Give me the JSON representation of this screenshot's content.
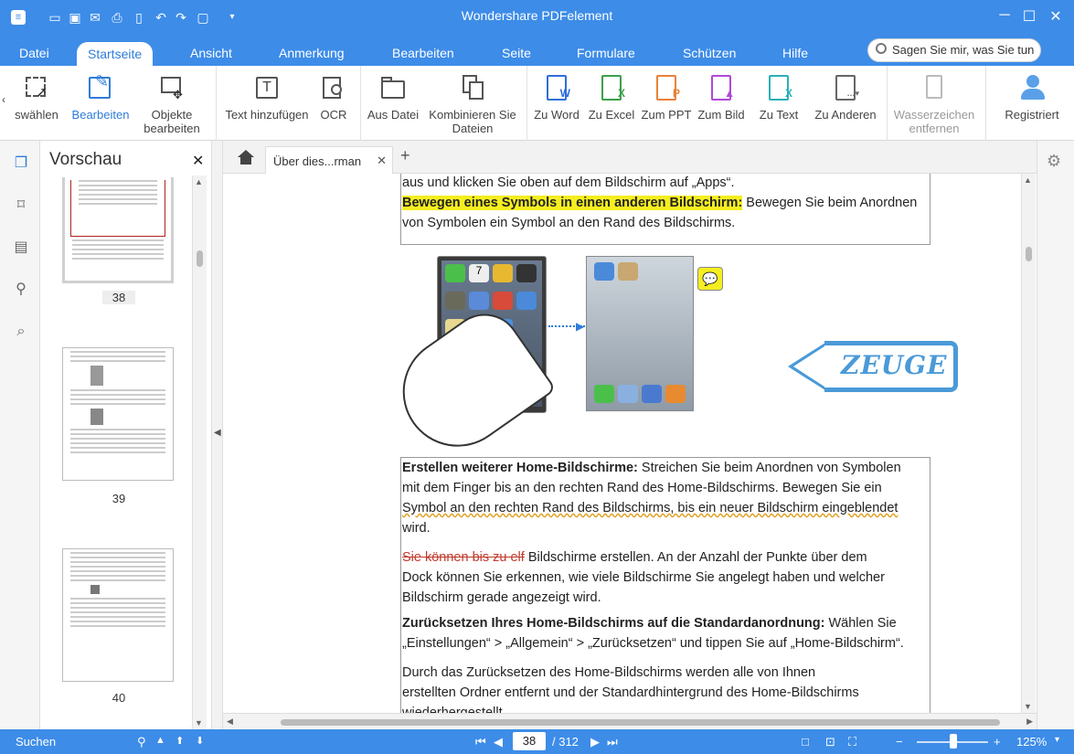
{
  "app": {
    "title": "Wondershare PDFelement"
  },
  "menu": {
    "tabs": [
      "Datei",
      "Startseite",
      "Ansicht",
      "Anmerkung",
      "Bearbeiten",
      "Seite",
      "Formulare",
      "Schützen",
      "Hilfe"
    ],
    "active": "Startseite",
    "search_placeholder": "Sagen Sie mir, was Sie tun"
  },
  "ribbon": {
    "select": "swählen",
    "edit": "Bearbeiten",
    "objects_1": "Objekte",
    "objects_2": "bearbeiten",
    "add_text": "Text hinzufügen",
    "ocr": "OCR",
    "from_file": "Aus Datei",
    "combine_1": "Kombinieren Sie",
    "combine_2": "Dateien",
    "to_word": "Zu Word",
    "to_excel": "Zu Excel",
    "to_ppt": "Zum PPT",
    "to_image": "Zum Bild",
    "to_text": "Zu Text",
    "to_other": "Zu Anderen",
    "remove_wm_1": "Wasserzeichen",
    "remove_wm_2": "entfernen",
    "registered": "Registriert"
  },
  "preview": {
    "title": "Vorschau",
    "pages": [
      "38",
      "39",
      "40"
    ]
  },
  "tabs": {
    "doc_tab": "Über dies...rman"
  },
  "document": {
    "line_top": "aus und klicken Sie oben auf dem Bildschirm auf „Apps“.",
    "move_heading": "Bewegen eines Symbols in einen anderen Bildschirm:",
    "move_body_1": " Bewegen Sie beim Anordnen",
    "move_body_2": "von Symbolen ein Symbol an den Rand des Bildschirms.",
    "stamp": "ZEUGE",
    "p1_heading": "Erstellen weiterer Home-Bildschirme:",
    "p1_l1": " Streichen Sie beim Anordnen von Symbolen",
    "p1_l2": "mit dem Finger bis an den rechten Rand des Home-Bildschirms. Bewegen Sie ein",
    "p1_l3": "Symbol an den rechten Rand des Bildschirms, bis ein neuer Bildschirm eingeblendet",
    "p1_l4": "wird.",
    "p2_strike": "Sie können bis zu elf",
    "p2_l1": " Bildschirme erstellen. An der Anzahl der Punkte über dem",
    "p2_l2": "Dock können Sie erkennen, wie viele Bildschirme Sie angelegt haben und welcher",
    "p2_l3": "Bildschirm gerade angezeigt wird.",
    "p3_heading": "Zurücksetzen Ihres Home-Bildschirms auf die Standardanordnung:",
    "p3_l1": " Wählen Sie",
    "p3_l2": "„Einstellungen“ > „Allgemein“ > „Zurücksetzen“ und tippen Sie auf „Home-Bildschirm“.",
    "p4_l1": "Durch das Zurücksetzen des Home-Bildschirms werden alle von Ihnen",
    "p4_l2": "erstellten Ordner entfernt und der Standardhintergrund des Home-Bildschirms",
    "p4_l3": "wiederhergestellt."
  },
  "status": {
    "search": "Suchen",
    "page": "38",
    "total": "/ 312",
    "zoom": "125%"
  },
  "colors": {
    "accent": "#3d8ce8",
    "highlight": "#f5ee20"
  }
}
